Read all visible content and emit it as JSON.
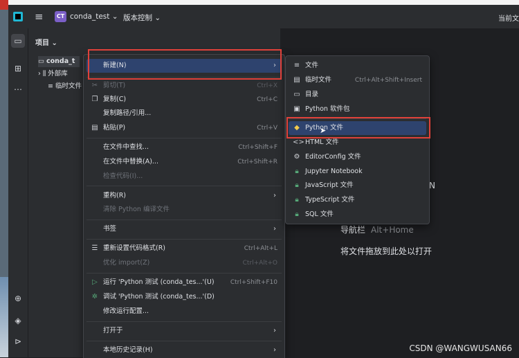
{
  "titlebar": {
    "project_initials": "CT",
    "project_name": "conda_test",
    "vcs_label": "版本控制",
    "right_label": "当前文"
  },
  "project_panel": {
    "title": "项目",
    "tree": [
      {
        "label": "conda_t",
        "icon": "folder-icon"
      },
      {
        "label": "外部库",
        "icon": "library-icon"
      },
      {
        "label": "临时文件",
        "icon": "scratch-icon"
      }
    ]
  },
  "context_menu": {
    "items": [
      {
        "label": "新建(N)",
        "submenu": true,
        "highlighted": true
      },
      {
        "label": "剪切(T)",
        "shortcut": "Ctrl+X",
        "icon": "scissors-icon",
        "disabled": true
      },
      {
        "label": "复制(C)",
        "shortcut": "Ctrl+C",
        "icon": "copy-icon"
      },
      {
        "label": "复制路径/引用..."
      },
      {
        "label": "粘贴(P)",
        "shortcut": "Ctrl+V",
        "icon": "paste-icon"
      },
      {
        "label": "在文件中查找...",
        "shortcut": "Ctrl+Shift+F"
      },
      {
        "label": "在文件中替换(A)...",
        "shortcut": "Ctrl+Shift+R"
      },
      {
        "label": "检查代码(I)...",
        "disabled": true
      },
      {
        "label": "重构(R)",
        "submenu": true
      },
      {
        "label": "清除 Python 编译文件",
        "disabled": true
      },
      {
        "label": "书签",
        "submenu": true
      },
      {
        "label": "重新设置代码格式(R)",
        "shortcut": "Ctrl+Alt+L",
        "icon": "format-icon"
      },
      {
        "label": "优化 import(Z)",
        "shortcut": "Ctrl+Alt+O",
        "disabled": true
      },
      {
        "label": "运行 'Python 测试 (conda_tes...'(U)",
        "shortcut": "Ctrl+Shift+F10",
        "icon": "run-icon"
      },
      {
        "label": "调试 'Python 测试 (conda_tes...'(D)",
        "icon": "debug-icon"
      },
      {
        "label": "修改运行配置..."
      },
      {
        "label": "打开于",
        "submenu": true
      },
      {
        "label": "本地历史记录(H)",
        "submenu": true
      }
    ]
  },
  "new_submenu": {
    "items": [
      {
        "label": "文件",
        "shortcut": "",
        "icon": "file-icon"
      },
      {
        "label": "临时文件",
        "shortcut": "Ctrl+Alt+Shift+Insert",
        "icon": "scratch-file-icon"
      },
      {
        "label": "目录",
        "shortcut": "",
        "icon": "directory-icon"
      },
      {
        "label": "Python 软件包",
        "shortcut": "",
        "icon": "package-icon"
      },
      {
        "label": "Python 文件",
        "shortcut": "",
        "icon": "python-icon",
        "highlighted": true
      },
      {
        "label": "HTML 文件",
        "shortcut": "",
        "icon": "html-icon"
      },
      {
        "label": "EditorConfig 文件",
        "shortcut": "",
        "icon": "gear-icon"
      },
      {
        "label": "Jupyter Notebook",
        "shortcut": "",
        "icon": "lock-icon"
      },
      {
        "label": "JavaScript 文件",
        "shortcut": "",
        "icon": "lock-icon"
      },
      {
        "label": "TypeScript 文件",
        "shortcut": "",
        "icon": "lock-icon"
      },
      {
        "label": "SQL 文件",
        "shortcut": "",
        "icon": "lock-icon"
      }
    ]
  },
  "editor_hints": {
    "partial": "N",
    "navbar": "导航栏",
    "navbar_key": "Alt+Home",
    "drop": "将文件拖放到此处以打开"
  },
  "watermark": "CSDN @WANGWUSAN66",
  "colors": {
    "accent": "#2e436e",
    "annotation_red": "#e0413a",
    "lock_green": "#56a878"
  }
}
